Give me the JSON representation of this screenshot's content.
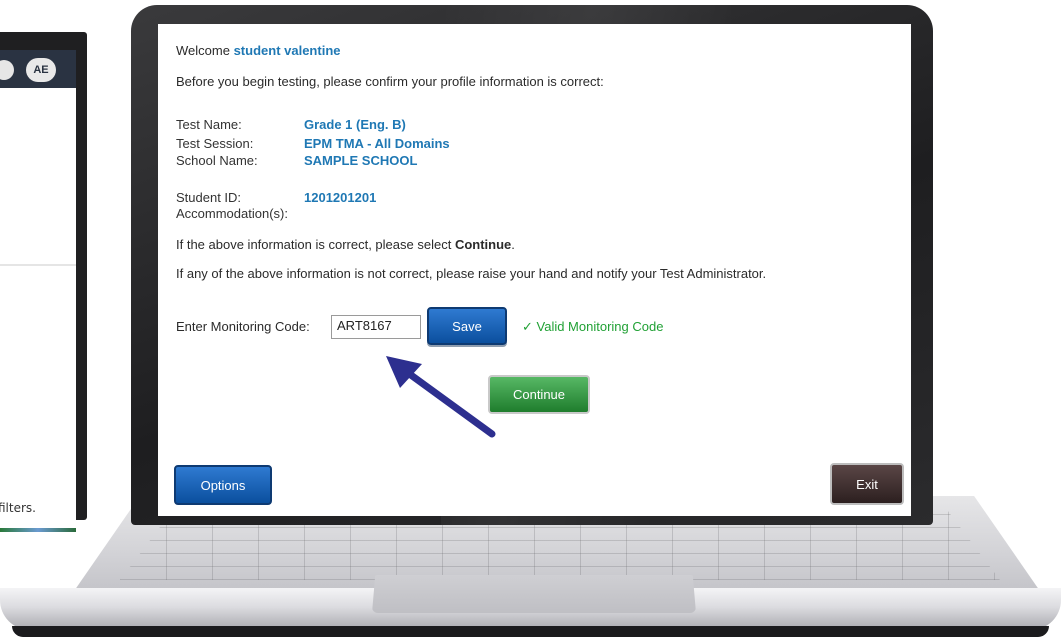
{
  "background_window": {
    "avatar_initials": "AE",
    "footer_text": "filters."
  },
  "welcome": {
    "prefix": "Welcome",
    "student_name": "student valentine"
  },
  "instructions": {
    "confirm": "Before you begin testing, please confirm your profile information is correct:",
    "if_correct_prefix": "If the above information is correct, please select",
    "if_correct_action": "Continue",
    "if_correct_suffix": ".",
    "if_incorrect": "If any of the above information is not correct, please raise your hand and notify your Test Administrator."
  },
  "profile": {
    "test_name_label": "Test Name:",
    "test_name_value": "Grade 1 (Eng. B)",
    "test_session_label": "Test Session:",
    "test_session_value": "EPM TMA - All Domains",
    "school_name_label": "School Name:",
    "school_name_value": "SAMPLE SCHOOL",
    "student_id_label": "Student ID:",
    "student_id_value": "1201201201",
    "accommodations_label": "Accommodation(s):"
  },
  "monitoring": {
    "label": "Enter Monitoring Code:",
    "code_value": "ART8167",
    "save_label": "Save",
    "valid_message": "✓ Valid Monitoring Code"
  },
  "buttons": {
    "continue_label": "Continue",
    "options_label": "Options",
    "exit_label": "Exit"
  },
  "colors": {
    "accent_blue": "#1f78b4",
    "valid_green": "#21a135",
    "arrow": "#2d2f8f"
  }
}
